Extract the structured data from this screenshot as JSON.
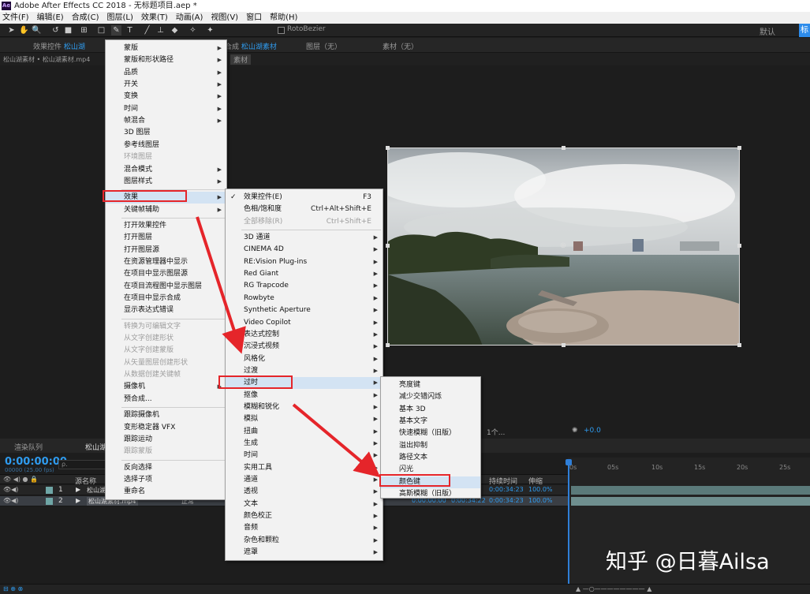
{
  "window": {
    "app_icon": "Ae",
    "title": "Adobe After Effects CC 2018 - 无标题项目.aep *"
  },
  "menubar": [
    "文件(F)",
    "编辑(E)",
    "合成(C)",
    "图层(L)",
    "效果(T)",
    "动画(A)",
    "视图(V)",
    "窗口",
    "帮助(H)"
  ],
  "toolbar": {
    "roto_label": "RotoBezier",
    "workspace_default": "默认",
    "workspace_learn": "标"
  },
  "panels": {
    "effect_controls": "效果控件",
    "effect_controls_layer": "松山湖",
    "comp_tab_prefix": "合成",
    "comp_tab_name": "松山湖素材",
    "layer_tab": "图层（无）",
    "footage_tab": "素材（无）",
    "breadcrumb": "松山湖素材 • 松山湖素材.mp4",
    "comp_chip": "素材"
  },
  "timeline": {
    "render_queue_tab": "渲染队列",
    "comp_tab": "松山湖",
    "timecode": "0:00:00:00",
    "fps": "00000 (25.00 fps)",
    "search_placeholder": "ρ.",
    "col_source": "源名称",
    "col_duration": "持续时间",
    "col_stretch": "伸缩",
    "viewer_quality": "1个...",
    "exposure": "+0.0",
    "ruler": [
      "0s",
      "05s",
      "10s",
      "15s",
      "20s",
      "25s"
    ],
    "layers": [
      {
        "num": "1",
        "name": "松山湖",
        "mode": "",
        "in": "",
        "out": "",
        "duration": "0:00:34:23",
        "stretch": "100.0%"
      },
      {
        "num": "2",
        "name": "松山湖素材.mp4",
        "mode": "正常",
        "in": "0:00:00:00",
        "out": "0:00:34:22",
        "duration": "0:00:34:23",
        "stretch": "100.0%"
      }
    ]
  },
  "menu_layer": [
    {
      "label": "蒙版",
      "sub": true
    },
    {
      "label": "蒙版和形状路径",
      "sub": true
    },
    {
      "label": "品质",
      "sub": true
    },
    {
      "label": "开关",
      "sub": true
    },
    {
      "label": "变换",
      "sub": true
    },
    {
      "label": "时间",
      "sub": true
    },
    {
      "label": "帧混合",
      "sub": true
    },
    {
      "label": "3D 图层"
    },
    {
      "label": "参考线图层"
    },
    {
      "label": "环境图层",
      "disabled": true
    },
    {
      "label": "混合模式",
      "sub": true
    },
    {
      "label": "图层样式",
      "sub": true
    },
    {
      "sep": true
    },
    {
      "label": "效果",
      "sub": true
    },
    {
      "label": "关键帧辅助",
      "sub": true
    },
    {
      "sep": true
    },
    {
      "label": "打开效果控件"
    },
    {
      "label": "打开图层"
    },
    {
      "label": "打开图层源"
    },
    {
      "label": "在资源管理器中显示"
    },
    {
      "label": "在项目中显示图层源"
    },
    {
      "label": "在项目流程图中显示图层"
    },
    {
      "label": "在项目中显示合成"
    },
    {
      "label": "显示表达式错误"
    },
    {
      "sep": true
    },
    {
      "label": "转换为可编辑文字",
      "disabled": true
    },
    {
      "label": "从文字创建形状",
      "disabled": true
    },
    {
      "label": "从文字创建蒙版",
      "disabled": true
    },
    {
      "label": "从矢量图层创建形状",
      "disabled": true
    },
    {
      "label": "从数据创建关键帧",
      "disabled": true
    },
    {
      "label": "摄像机",
      "sub": true
    },
    {
      "label": "预合成..."
    },
    {
      "sep": true
    },
    {
      "label": "跟踪摄像机"
    },
    {
      "label": "变形稳定器 VFX"
    },
    {
      "label": "跟踪运动"
    },
    {
      "label": "跟踪蒙版",
      "disabled": true
    },
    {
      "sep": true
    },
    {
      "label": "反向选择"
    },
    {
      "label": "选择子项"
    },
    {
      "label": "重命名"
    }
  ],
  "menu_effect": [
    {
      "label": "效果控件(E)",
      "shortcut": "F3",
      "checked": true
    },
    {
      "label": "色相/饱和度",
      "shortcut": "Ctrl+Alt+Shift+E"
    },
    {
      "label": "全部移除(R)",
      "shortcut": "Ctrl+Shift+E",
      "disabled": true
    },
    {
      "sep": true
    },
    {
      "label": "3D 通道",
      "sub": true
    },
    {
      "label": "CINEMA 4D",
      "sub": true
    },
    {
      "label": "RE:Vision Plug-ins",
      "sub": true
    },
    {
      "label": "Red Giant",
      "sub": true
    },
    {
      "label": "RG Trapcode",
      "sub": true
    },
    {
      "label": "Rowbyte",
      "sub": true
    },
    {
      "label": "Synthetic Aperture",
      "sub": true
    },
    {
      "label": "Video Copilot",
      "sub": true
    },
    {
      "label": "表达式控制",
      "sub": true
    },
    {
      "label": "沉浸式视频",
      "sub": true
    },
    {
      "label": "风格化",
      "sub": true
    },
    {
      "label": "过渡",
      "sub": true
    },
    {
      "label": "过时",
      "sub": true
    },
    {
      "label": "抠像",
      "sub": true
    },
    {
      "label": "模糊和锐化",
      "sub": true
    },
    {
      "label": "模拟",
      "sub": true
    },
    {
      "label": "扭曲",
      "sub": true
    },
    {
      "label": "生成",
      "sub": true
    },
    {
      "label": "时间",
      "sub": true
    },
    {
      "label": "实用工具",
      "sub": true
    },
    {
      "label": "通道",
      "sub": true
    },
    {
      "label": "透视",
      "sub": true
    },
    {
      "label": "文本",
      "sub": true
    },
    {
      "label": "颜色校正",
      "sub": true
    },
    {
      "label": "音频",
      "sub": true
    },
    {
      "label": "杂色和颗粒",
      "sub": true
    },
    {
      "label": "遮罩",
      "sub": true
    }
  ],
  "menu_obsolete": [
    {
      "label": "亮度键"
    },
    {
      "label": "减少交错闪烁"
    },
    {
      "label": "基本 3D"
    },
    {
      "label": "基本文字"
    },
    {
      "label": "快速模糊（旧版）"
    },
    {
      "label": "溢出抑制"
    },
    {
      "label": "路径文本"
    },
    {
      "label": "闪光"
    },
    {
      "label": "颜色键"
    },
    {
      "label": "高斯模糊（旧版）"
    }
  ],
  "watermark": "知乎 @日暮Ailsa",
  "colors": {
    "accent_blue": "#2f9cf0",
    "annotation_red": "#e5252a",
    "menu_bg": "#f2f2f2"
  }
}
